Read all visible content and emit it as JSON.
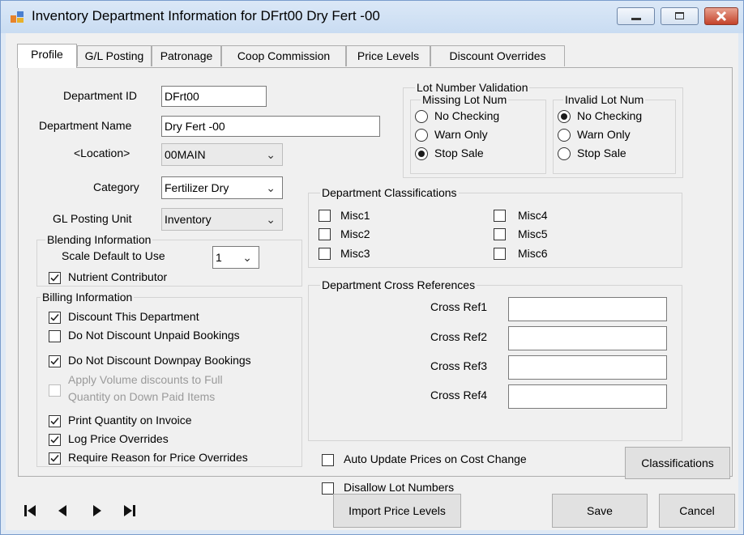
{
  "window": {
    "title": "Inventory Department Information for DFrt00  Dry Fert -00"
  },
  "tabs": [
    "Profile",
    "G/L Posting",
    "Patronage",
    "Coop Commission",
    "Price Levels",
    "Discount Overrides"
  ],
  "fields": {
    "department_id_label": "Department ID",
    "department_id": "DFrt00",
    "department_name_label": "Department Name",
    "department_name": "Dry Fert -00",
    "location_label": "<Location>",
    "location": "00MAIN",
    "category_label": "Category",
    "category": "Fertilizer Dry",
    "gl_posting_unit_label": "GL Posting Unit",
    "gl_posting_unit": "Inventory"
  },
  "blending": {
    "title": "Blending Information",
    "scale_label": "Scale Default to Use",
    "scale_value": "1",
    "nutrient_label": "Nutrient Contributor"
  },
  "billing": {
    "title": "Billing Information",
    "discount_dept": "Discount This Department",
    "no_discount_unpaid": "Do Not Discount Unpaid Bookings",
    "no_discount_downpay": "Do Not Discount Downpay Bookings",
    "apply_volume_line1": "Apply Volume discounts to Full",
    "apply_volume_line2": "Quantity on Down Paid Items",
    "print_qty": "Print Quantity on Invoice",
    "log_price": "Log Price Overrides",
    "require_reason": "Require Reason for Price Overrides"
  },
  "lot": {
    "title": "Lot Number Validation",
    "missing_title": "Missing Lot Num",
    "invalid_title": "Invalid Lot Num",
    "opt_no_checking": "No Checking",
    "opt_warn_only": "Warn Only",
    "opt_stop_sale": "Stop Sale"
  },
  "classifications": {
    "title": "Department Classifications",
    "misc1": "Misc1",
    "misc2": "Misc2",
    "misc3": "Misc3",
    "misc4": "Misc4",
    "misc5": "Misc5",
    "misc6": "Misc6"
  },
  "cross_refs": {
    "title": "Department Cross References",
    "ref1": "Cross Ref1",
    "ref2": "Cross Ref2",
    "ref3": "Cross Ref3",
    "ref4": "Cross Ref4"
  },
  "options": {
    "auto_update": "Auto Update Prices on Cost Change",
    "disallow_lot": "Disallow Lot Numbers"
  },
  "buttons": {
    "classifications": "Classifications",
    "import_price_levels": "Import Price Levels",
    "save": "Save",
    "cancel": "Cancel"
  },
  "colors": {
    "title_bar": "#c9dcf2",
    "close_button": "#c4422a",
    "client_bg": "#f0f0f0"
  },
  "icons": [
    "app-icon",
    "minimize-icon",
    "maximize-icon",
    "close-icon",
    "first-record-icon",
    "previous-record-icon",
    "next-record-icon",
    "last-record-icon"
  ]
}
